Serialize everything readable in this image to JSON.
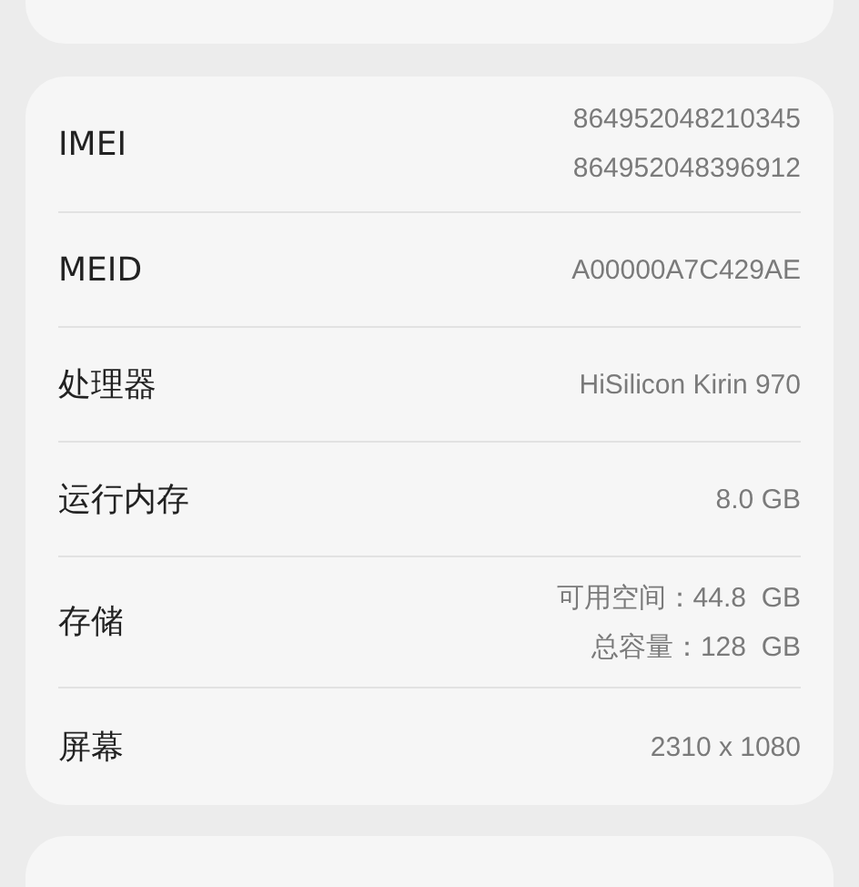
{
  "rows": [
    {
      "label": "IMEI",
      "values": [
        "864952048210345",
        "864952048396912"
      ]
    },
    {
      "label": "MEID",
      "values": [
        "A00000A7C429AE"
      ]
    },
    {
      "label": "处理器",
      "values": [
        "HiSilicon Kirin 970"
      ]
    },
    {
      "label": "运行内存",
      "values": [
        "8.0 GB"
      ]
    },
    {
      "label": "存储",
      "values": [
        "可用空间：44.8  GB",
        "总容量：128  GB"
      ]
    },
    {
      "label": "屏幕",
      "values": [
        "2310 x 1080"
      ]
    }
  ]
}
